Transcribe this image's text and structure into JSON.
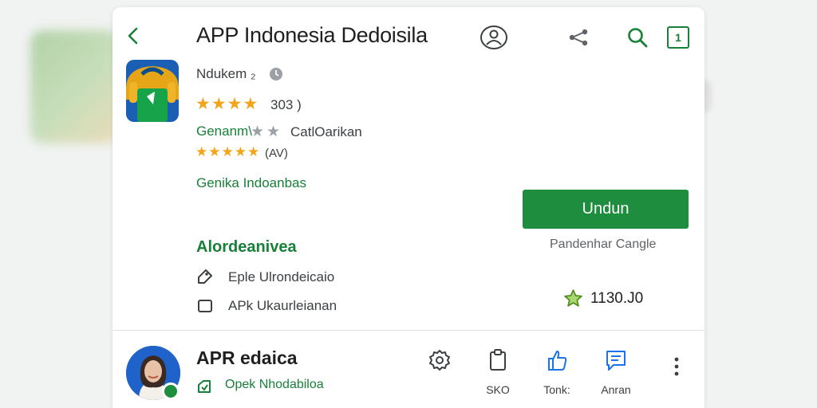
{
  "header": {
    "title": "APP Indonesia Dedoisila",
    "back_icon": "back-arrow-icon",
    "share_icon": "share-icon",
    "search_icon": "search-icon",
    "tab_count": "1"
  },
  "app": {
    "developer": "Ndukem ₂",
    "rating_stars": "★★★★",
    "rating_count": "303 )",
    "genre": "Genanm\\",
    "genre_stars": "★★",
    "genre_tag": "CatlOarikan",
    "sub_rating_stars": "★★★★★",
    "sub_rating_count": "(AV)",
    "category": "Genika Indoanbas"
  },
  "install": {
    "label": "Undun",
    "subtext": "Pandenhar Cangle"
  },
  "details": {
    "section_title": "Alordeanivea",
    "features": [
      "Eple Ulrondeicaio",
      "APk Ukaurleianan"
    ],
    "rating_value": "1130.J0"
  },
  "bottom": {
    "title": "APR edaica",
    "subtitle": "Opek Nhodabiloa",
    "actions": [
      {
        "label": "",
        "icon": "settings-icon"
      },
      {
        "label": "SKO",
        "icon": "clipboard-icon"
      },
      {
        "label": "Tonk:",
        "icon": "thumbs-up-icon"
      },
      {
        "label": "Anran",
        "icon": "message-icon"
      }
    ]
  },
  "colors": {
    "accent_green": "#1e8e3e",
    "text_green": "#188038",
    "star_gold": "#f2a51b",
    "link_blue": "#1a73e8"
  }
}
